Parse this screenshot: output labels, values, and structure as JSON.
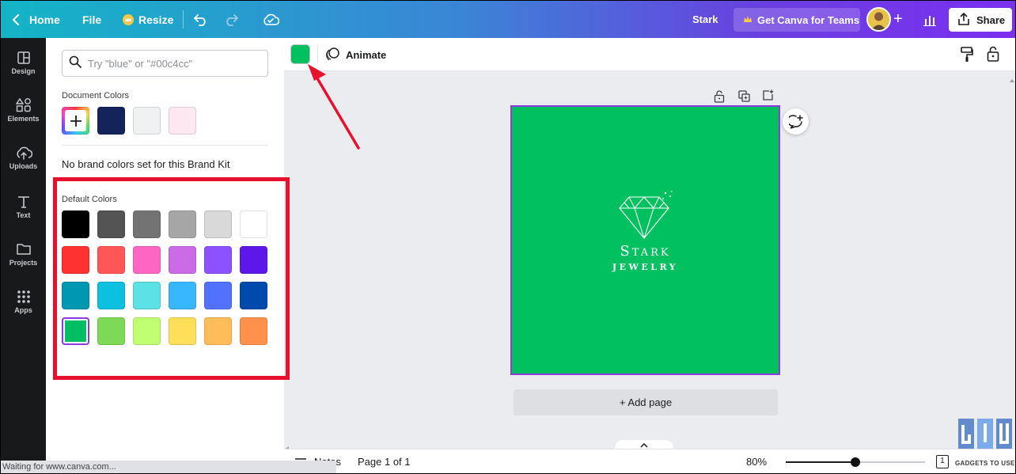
{
  "topbar": {
    "home_label": "Home",
    "file_label": "File",
    "resize_label": "Resize",
    "design_name": "Stark",
    "teams_label": "Get Canva for Teams",
    "share_label": "Share"
  },
  "rail": {
    "items": [
      {
        "label": "Design",
        "icon": "layout-icon"
      },
      {
        "label": "Elements",
        "icon": "shapes-icon"
      },
      {
        "label": "Uploads",
        "icon": "cloud-upload-icon"
      },
      {
        "label": "Text",
        "icon": "text-icon"
      },
      {
        "label": "Projects",
        "icon": "folder-icon"
      },
      {
        "label": "Apps",
        "icon": "grid-icon"
      }
    ]
  },
  "panel": {
    "search_placeholder": "Try \"blue\" or \"#00c4cc\"",
    "document_colors_title": "Document Colors",
    "document_colors": [
      "#14235a",
      "#f0f1f2",
      "#fde8f2"
    ],
    "no_brand_text": "No brand colors set for this Brand Kit",
    "default_colors_title": "Default Colors",
    "default_colors": [
      [
        "#000000",
        "#545454",
        "#737373",
        "#a6a6a6",
        "#d9d9d9",
        "#ffffff"
      ],
      [
        "#ff3131",
        "#ff5757",
        "#ff66c4",
        "#cb6ce6",
        "#8c52ff",
        "#5e17eb"
      ],
      [
        "#0097b2",
        "#0cc0df",
        "#5ce1e6",
        "#38b6ff",
        "#5271ff",
        "#004aad"
      ],
      [
        "#00bf63",
        "#7ed957",
        "#c1ff72",
        "#ffde59",
        "#ffbd59",
        "#ff914d"
      ]
    ],
    "selected_color": "#00bf63"
  },
  "toolbar": {
    "current_color": "#00c060",
    "animate_label": "Animate"
  },
  "canvas": {
    "logo_line1": "Stark",
    "logo_line2": "JEWELRY",
    "add_page_label": "+ Add page",
    "background_color": "#00c060"
  },
  "bottombar": {
    "notes_label": "Notes",
    "page_label": "Page 1 of 1",
    "zoom_label": "80%",
    "zoom_fraction": 0.5,
    "page_count": "1"
  },
  "status": {
    "text": "Waiting for www.canva.com..."
  },
  "watermark": {
    "text": "GADGETS TO USE"
  }
}
